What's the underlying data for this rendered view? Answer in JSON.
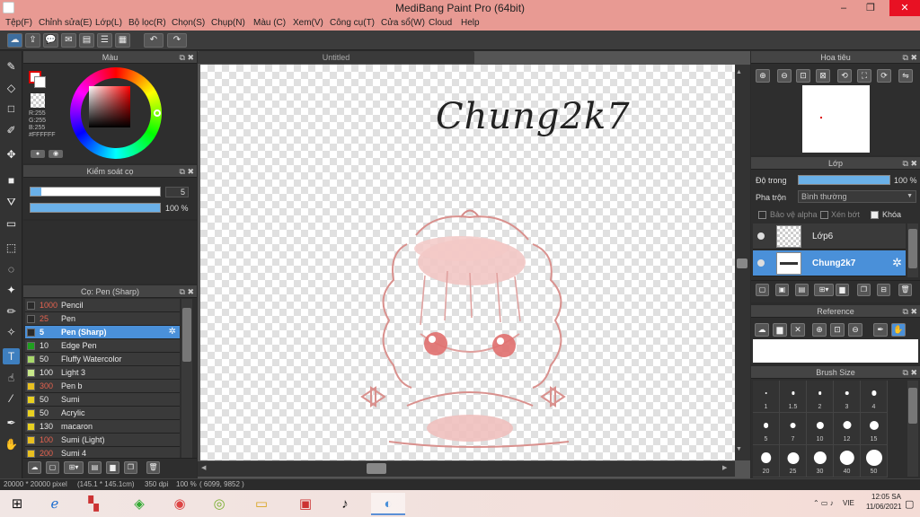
{
  "window": {
    "title": "MediBang Paint Pro (64bit)",
    "minimize": "‒",
    "maximize": "❐",
    "close": "✕"
  },
  "menu": [
    "Tệp(F)",
    "Chỉnh sửa(E)",
    "Lớp(L)",
    "Bộ lọc(R)",
    "Chọn(S)",
    "Chụp(N)",
    "Màu (C)",
    "Xem(V)",
    "Công cụ(T)",
    "Cửa sổ(W)",
    "Cloud",
    "Help"
  ],
  "color_panel": {
    "title": "Màu",
    "r": "R:255",
    "g": "G:255",
    "b": "B:255",
    "hex": "#FFFFFF"
  },
  "brush_control": {
    "title": "Kiểm soát cọ",
    "size_value": "5",
    "opacity_value": "100 %",
    "opacity_fraction": 1.0
  },
  "brush_panel": {
    "title": "Cọ: Pen (Sharp)",
    "items": [
      {
        "size": "1000",
        "name": "Pencil",
        "color": "#2a2a2a",
        "red": true
      },
      {
        "size": "25",
        "name": "Pen",
        "color": "#2a2a2a",
        "red": true
      },
      {
        "size": "5",
        "name": "Pen (Sharp)",
        "color": "#2a2a2a",
        "red": true,
        "selected": true
      },
      {
        "size": "10",
        "name": "Edge Pen",
        "color": "#1fa01f",
        "red": false
      },
      {
        "size": "50",
        "name": "Fluffy Watercolor",
        "color": "#a8d86a",
        "red": false
      },
      {
        "size": "100",
        "name": "Light 3",
        "color": "#c8e88a",
        "red": false
      },
      {
        "size": "300",
        "name": "Pen b",
        "color": "#e8c020",
        "red": true
      },
      {
        "size": "50",
        "name": "Sumi",
        "color": "#e8d020",
        "red": false
      },
      {
        "size": "50",
        "name": "Acrylic",
        "color": "#e8d020",
        "red": false
      },
      {
        "size": "130",
        "name": "macaron",
        "color": "#e8d020",
        "red": false
      },
      {
        "size": "100",
        "name": "Sumi (Light)",
        "color": "#e8c020",
        "red": true
      },
      {
        "size": "200",
        "name": "Sumi 4",
        "color": "#e8c020",
        "red": true
      }
    ]
  },
  "canvas": {
    "tab": "Untitled",
    "text": "Chung2k7"
  },
  "navigator": {
    "title": "Hoa tiêu"
  },
  "layer_panel": {
    "title": "Lớp",
    "opacity_label": "Độ trong",
    "opacity_value": "100 %",
    "opacity_fraction": 1.0,
    "blend_label": "Pha trộn",
    "blend_value": "Bình thường",
    "protect_alpha": "Bảo vệ alpha",
    "clipping": "Xén bớt",
    "lock": "Khóa",
    "layers": [
      {
        "name": "Lớp6",
        "selected": false
      },
      {
        "name": "Chung2k7",
        "selected": true
      }
    ]
  },
  "reference": {
    "title": "Reference"
  },
  "brush_size": {
    "title": "Brush Size",
    "values": [
      "1",
      "1.5",
      "2",
      "3",
      "4",
      "5",
      "7",
      "10",
      "12",
      "15",
      "20",
      "25",
      "30",
      "40",
      "50"
    ]
  },
  "status": {
    "canvas_size": "20000 * 20000 pixel",
    "physical": "(145.1 * 145.1cm)",
    "dpi": "350 dpi",
    "zoom": "100 %",
    "coords": "( 6099, 9852 )"
  },
  "taskbar": {
    "time": "12:05 SA",
    "date": "11/06/2021",
    "lang": "VIE"
  }
}
